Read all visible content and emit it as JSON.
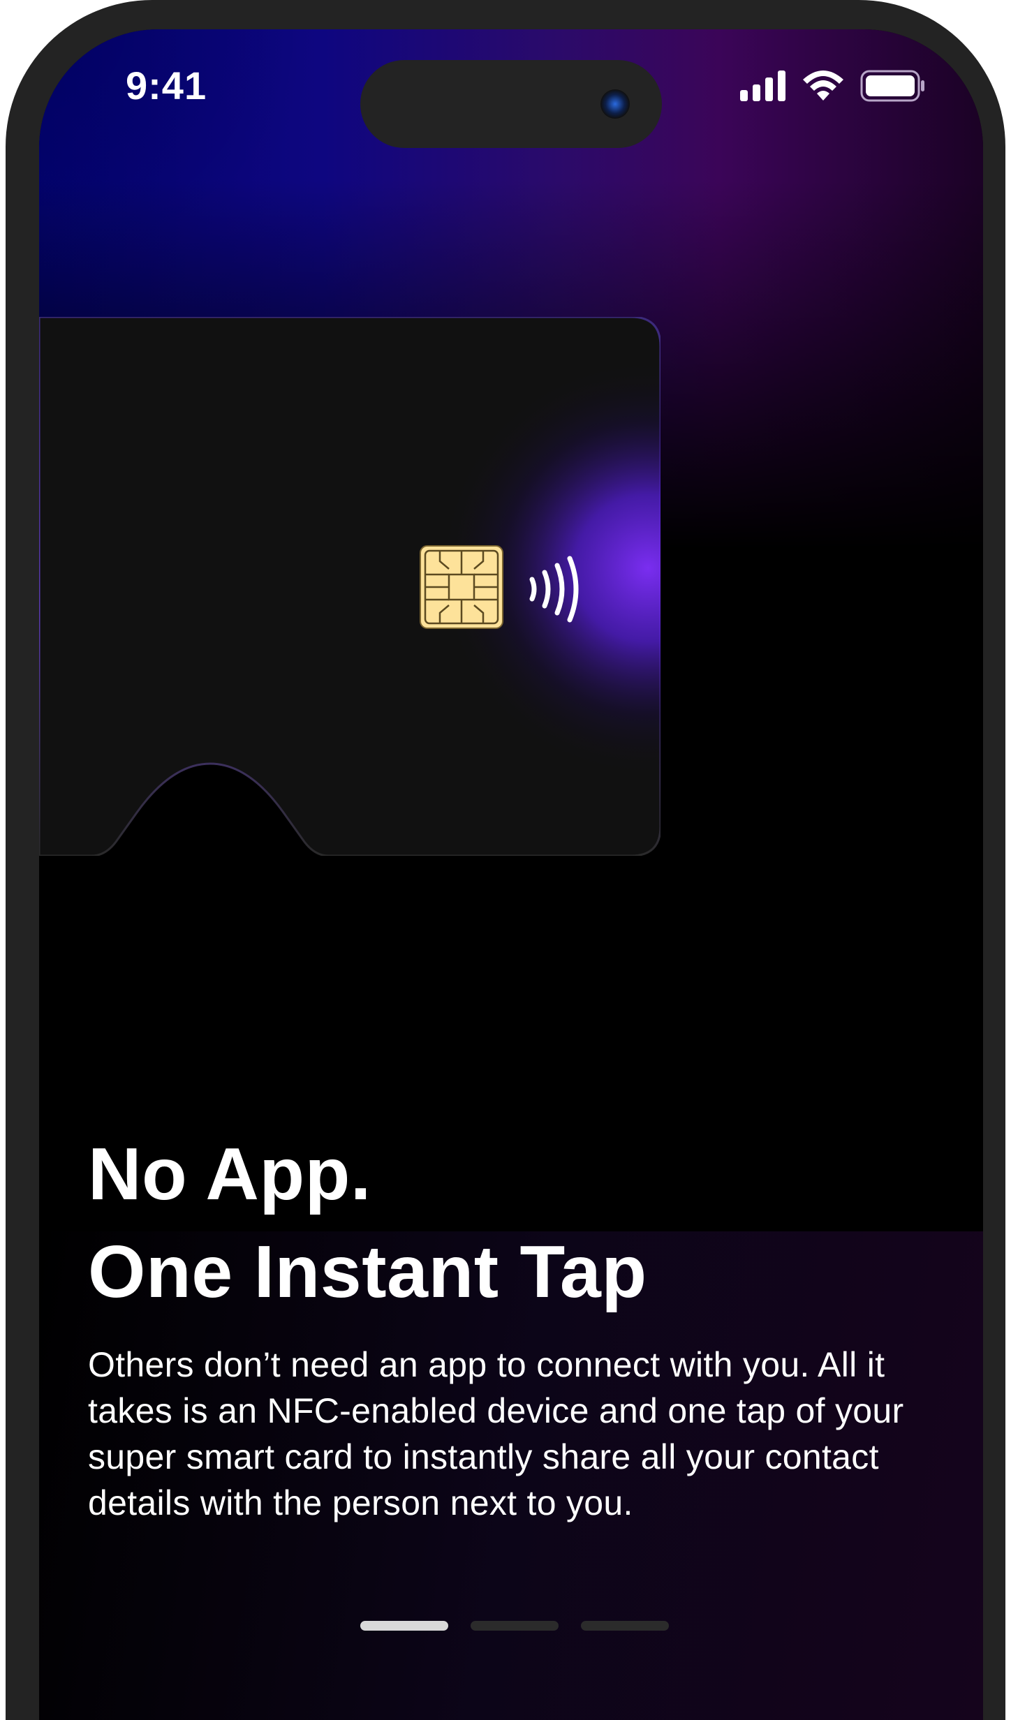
{
  "status_bar": {
    "time": "9:41",
    "icons": [
      "cellular-signal-icon",
      "wifi-icon",
      "battery-icon"
    ]
  },
  "card": {
    "chip_icon": "sim-chip-icon",
    "nfc_icon": "contactless-nfc-icon",
    "chip_color": "#fde29a",
    "glow_color": "#7a2ef0"
  },
  "onboarding": {
    "title_line1": "No App.",
    "title_line2": "One Instant Tap",
    "description": "Others don’t need an app to connect with you. All it takes is an NFC-enabled device and one tap of your super smart card to instantly share all your contact details with the person next to you."
  },
  "pager": {
    "total": 3,
    "active_index": 0
  },
  "colors": {
    "background": "#000000",
    "accent_blue": "#0e0680",
    "accent_purple": "#3b0558",
    "text": "#ffffff"
  }
}
